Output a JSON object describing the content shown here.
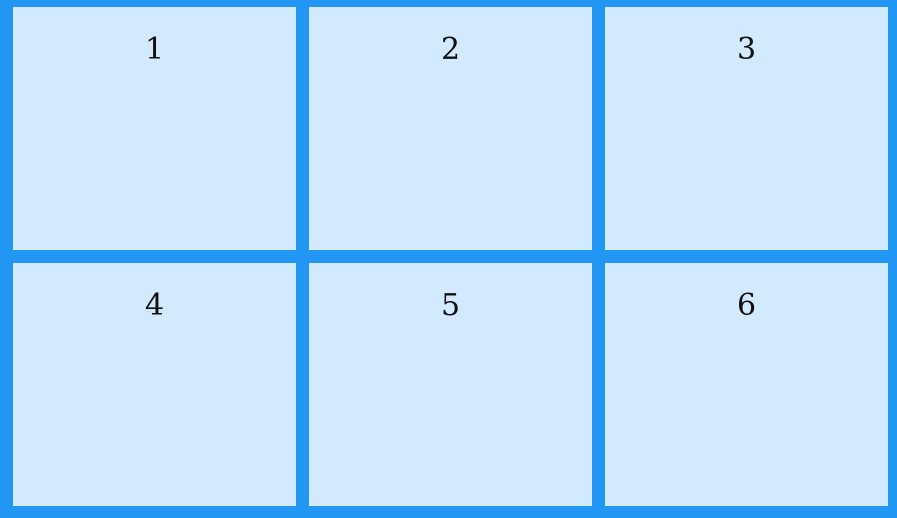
{
  "grid": {
    "items": [
      "1",
      "2",
      "3",
      "4",
      "5",
      "6"
    ]
  },
  "colors": {
    "background": "#2196f3",
    "cell": "#d3e9fd",
    "text": "#111111"
  }
}
